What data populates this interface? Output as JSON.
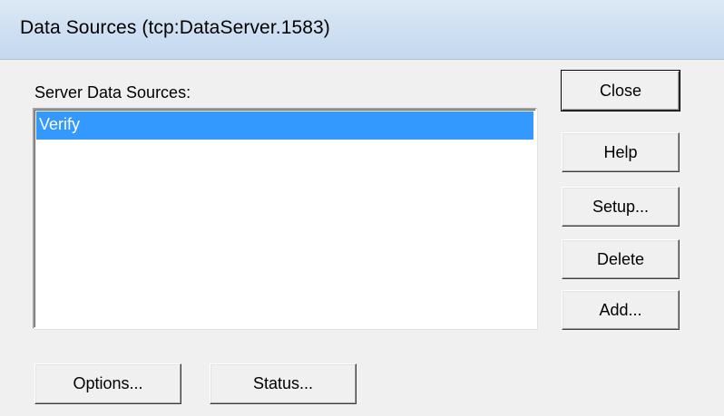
{
  "window": {
    "title": "Data Sources (tcp:DataServer.1583)"
  },
  "list": {
    "label": "Server Data Sources:",
    "items": [
      {
        "label": "Verify",
        "selected": true
      }
    ]
  },
  "buttons": {
    "close": "Close",
    "help": "Help",
    "setup": "Setup...",
    "delete": "Delete",
    "add": "Add...",
    "options": "Options...",
    "status": "Status..."
  },
  "colors": {
    "selection": "#3399ff",
    "dialog_bg": "#f0f0f0",
    "titlebar": "#cfe0f2"
  }
}
